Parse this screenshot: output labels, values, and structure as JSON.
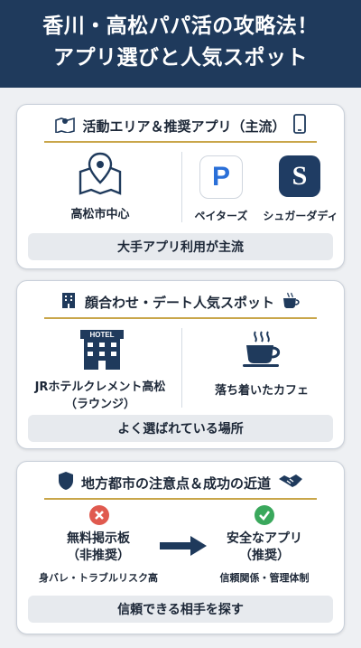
{
  "header": {
    "line1": "香川・高松パパ活の攻略法！",
    "line2": "アプリ選びと人気スポット"
  },
  "card1": {
    "title": "活動エリア＆推奨アプリ（主流）",
    "area_label": "高松市中心",
    "apps": [
      {
        "letter": "P",
        "name": "ペイターズ"
      },
      {
        "letter": "S",
        "name": "シュガーダディ"
      }
    ],
    "footer": "大手アプリ利用が主流"
  },
  "card2": {
    "title": "顔合わせ・デート人気スポット",
    "hotel_sign": "HOTEL",
    "spot1": "JRホテルクレメント高松\n（ラウンジ）",
    "spot2": "落ち着いたカフェ",
    "footer": "よく選ばれている場所"
  },
  "card3": {
    "title": "地方都市の注意点＆成功の近道",
    "bad_title": "無料掲示板\n（非推奨）",
    "bad_note": "身バレ・トラブルリスク高",
    "good_title": "安全なアプリ\n（推奨）",
    "good_note": "信頼関係・管理体制",
    "footer": "信頼できる相手を探す"
  },
  "colors": {
    "navy": "#1f3a5c",
    "gold": "#c9a64a",
    "red": "#e05a4f",
    "green": "#3aa85c",
    "pblue": "#2a6fd8",
    "sbg": "#1f3c63"
  }
}
